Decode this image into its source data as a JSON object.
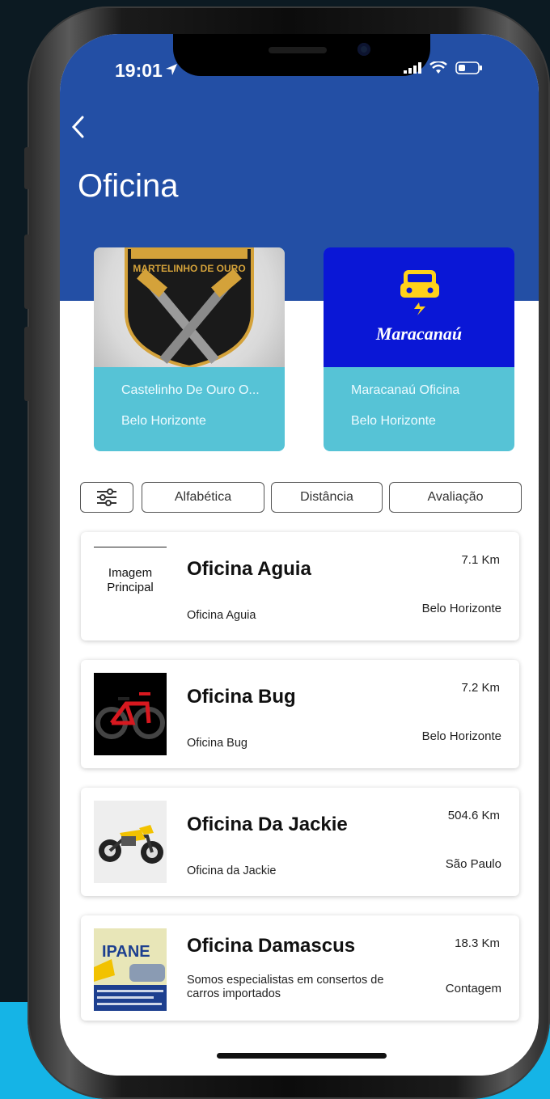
{
  "status_bar": {
    "time": "19:01"
  },
  "header": {
    "title": "Oficina"
  },
  "featured": [
    {
      "name": "Castelinho De Ouro O...",
      "city": "Belo Horizonte",
      "logo_text": "MARTELINHO DE OURO"
    },
    {
      "name": "Maracanaú Oficina",
      "city": "Belo Horizonte",
      "logo_text": "Maracanaú"
    }
  ],
  "filters": {
    "alphabetical": "Alfabética",
    "distance": "Distância",
    "rating": "Avaliação"
  },
  "list": [
    {
      "name": "Oficina Aguia",
      "description": "Oficina Aguia",
      "distance": "7.1 Km",
      "city": "Belo Horizonte",
      "placeholder": "Imagem Principal"
    },
    {
      "name": "Oficina Bug",
      "description": "Oficina Bug",
      "distance": "7.2 Km",
      "city": "Belo Horizonte"
    },
    {
      "name": "Oficina Da Jackie",
      "description": "Oficina da Jackie",
      "distance": "504.6 Km",
      "city": "São Paulo"
    },
    {
      "name": "Oficina Damascus",
      "description": "Somos especialistas em consertos de carros importados",
      "distance": "18.3 Km",
      "city": "Contagem",
      "thumb_text": "IPANE"
    }
  ],
  "colors": {
    "header_bg": "#234fa5",
    "featured_info_bg": "#56c3d6",
    "maracanau_bg": "#0a17d6",
    "accent_yellow": "#ffd21a"
  }
}
